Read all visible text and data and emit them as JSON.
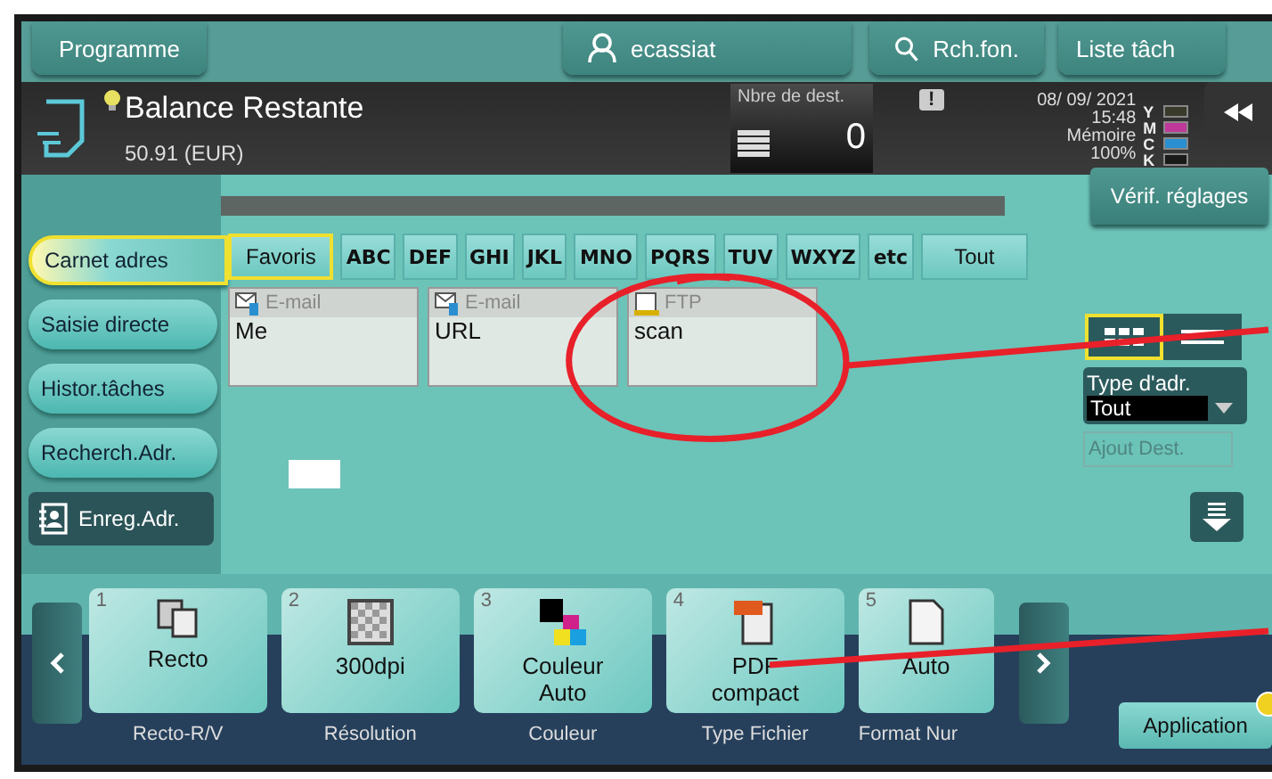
{
  "top_bar": {
    "program_button": "Programme",
    "user": "ecassiat",
    "search_button": "Rch.fon.",
    "jobs_button": "Liste tâch"
  },
  "info_bar": {
    "title": "Balance Restante",
    "balance": "50.91 (EUR)",
    "dest_label": "Nbre de dest.",
    "dest_count": "0",
    "alert": "!",
    "date": "08/ 09/ 2021",
    "time": "15:48",
    "memory_label": "Mémoire",
    "memory": "100%",
    "toners": [
      {
        "letter": "Y",
        "color": "#3a3a2a"
      },
      {
        "letter": "M",
        "color": "#c0399a"
      },
      {
        "letter": "C",
        "color": "#2a8fd0"
      },
      {
        "letter": "K",
        "color": "#1a1a1a"
      }
    ]
  },
  "check_settings": "Vérif. réglages",
  "side_tabs": [
    {
      "label": "Carnet adres",
      "selected": true
    },
    {
      "label": "Saisie directe",
      "selected": false
    },
    {
      "label": "Histor.tâches",
      "selected": false
    },
    {
      "label": "Recherch.Adr.",
      "selected": false
    }
  ],
  "register_button": "Enreg.Adr.",
  "index_tabs": [
    {
      "label": "Favoris",
      "selected": true
    },
    {
      "label": "ABC",
      "selected": false
    },
    {
      "label": "DEF",
      "selected": false
    },
    {
      "label": "GHI",
      "selected": false
    },
    {
      "label": "JKL",
      "selected": false
    },
    {
      "label": "MNO",
      "selected": false
    },
    {
      "label": "PQRS",
      "selected": false
    },
    {
      "label": "TUV",
      "selected": false
    },
    {
      "label": "WXYZ",
      "selected": false
    },
    {
      "label": "etc",
      "selected": false
    },
    {
      "label": "Tout",
      "selected": false
    }
  ],
  "addresses": [
    {
      "kind": "email",
      "type": "E-mail",
      "name": "Me"
    },
    {
      "kind": "email",
      "type": "E-mail",
      "name": "URL"
    },
    {
      "kind": "ftp",
      "type": "FTP",
      "name": "scan"
    }
  ],
  "view_modes": [
    {
      "kind": "grid",
      "selected": true
    },
    {
      "kind": "list",
      "selected": false
    }
  ],
  "address_type": {
    "label": "Type d'adr.",
    "value": "Tout"
  },
  "add_dest": {
    "label": "Ajout Dest.",
    "disabled": true
  },
  "functions": [
    {
      "number": "1",
      "kind": "duplex",
      "lines": [
        "Recto"
      ],
      "label": "Recto-R/V"
    },
    {
      "number": "2",
      "kind": "resolution",
      "lines": [
        "300dpi"
      ],
      "label": "Résolution"
    },
    {
      "number": "3",
      "kind": "color",
      "lines": [
        "Couleur",
        "Auto"
      ],
      "label": "Couleur"
    },
    {
      "number": "4",
      "kind": "pdf",
      "lines": [
        "PDF",
        "compact"
      ],
      "label": "Type Fichier"
    },
    {
      "number": "5",
      "kind": "page",
      "lines": [
        "Auto"
      ],
      "label": "Format Nur"
    }
  ],
  "application_button": "Application"
}
